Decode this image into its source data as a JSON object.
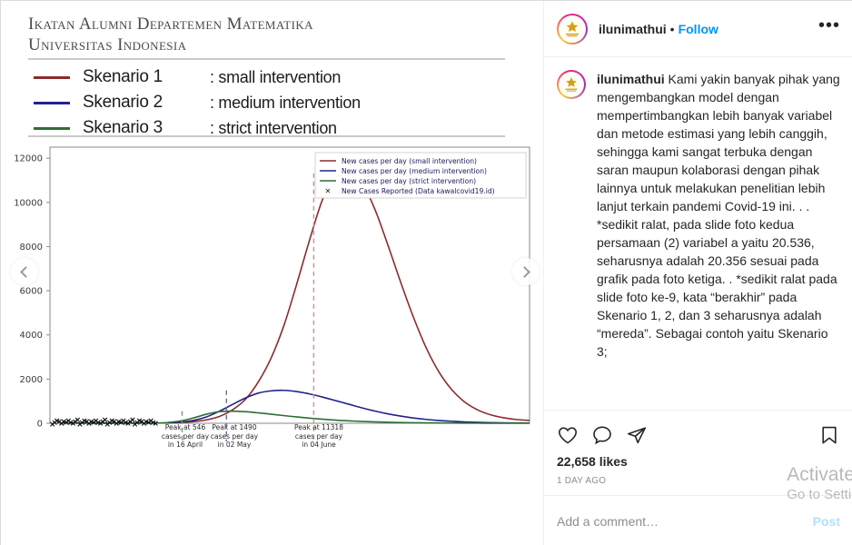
{
  "slide": {
    "title_line1": "Ikatan Alumni Departemen Matematika",
    "title_line2": "Universitas Indonesia",
    "legend": [
      {
        "name": "Skenario 1",
        "desc": ": small intervention",
        "color": "#8c2b2b"
      },
      {
        "name": "Skenario 2",
        "desc": ": medium intervention",
        "color": "#22228c"
      },
      {
        "name": "Skenario 3",
        "desc": ": strict intervention",
        "color": "#2c6e34"
      }
    ]
  },
  "chart_data": {
    "type": "line",
    "title": "",
    "xlabel": "",
    "ylabel": "",
    "ylim": [
      0,
      12500
    ],
    "yticks": [
      0,
      2000,
      4000,
      6000,
      8000,
      10000,
      12000
    ],
    "grid": false,
    "legend_position": "top-right",
    "legend_entries": [
      "New cases per day (small intervention)",
      "New cases per day (medium intervention)",
      "New cases per day (strict intervention)",
      "New Cases Reported (Data kawalcovid19.id)"
    ],
    "series": [
      {
        "name": "New cases per day (small intervention)",
        "color": "#8c2b2b",
        "peak_value": 11318,
        "peak_label": "in 04 June",
        "values": [
          10,
          20,
          40,
          80,
          160,
          320,
          620,
          1100,
          1900,
          3000,
          4500,
          6400,
          8400,
          10200,
          11200,
          11318,
          10900,
          9700,
          8100,
          6400,
          4800,
          3400,
          2300,
          1500,
          950,
          600,
          380,
          250,
          170,
          130
        ]
      },
      {
        "name": "New cases per day (medium intervention)",
        "color": "#22228c",
        "peak_value": 1490,
        "peak_label": "in 02 May",
        "values": [
          10,
          25,
          60,
          140,
          300,
          560,
          860,
          1150,
          1370,
          1470,
          1490,
          1430,
          1320,
          1180,
          1020,
          860,
          700,
          555,
          430,
          325,
          240,
          175,
          125,
          90,
          62,
          44,
          30,
          21,
          15,
          10
        ]
      },
      {
        "name": "New cases per day (strict intervention)",
        "color": "#2c6e34",
        "peak_value": 546,
        "peak_label": "in 16 April",
        "values": [
          12,
          40,
          110,
          250,
          420,
          530,
          546,
          520,
          470,
          410,
          345,
          285,
          230,
          182,
          142,
          110,
          84,
          63,
          47,
          35,
          26,
          19,
          14,
          10,
          7,
          5,
          4,
          3,
          2,
          2
        ]
      }
    ],
    "reported_marker": "x",
    "reported_marker_color": "#111111",
    "annotations": [
      {
        "color": "#2c6e34",
        "line1": "Peak at 546",
        "line2": "cases per day",
        "line3": "in 16 April"
      },
      {
        "color": "#5a5a7a",
        "line1": "Peak at 1490",
        "line2": "cases per day",
        "line3": "in 02 May"
      },
      {
        "color": "#cc7a7a",
        "line1": "Peak at 11318",
        "line2": "cases per day",
        "line3": "in 04 June"
      }
    ]
  },
  "carousel": {
    "prev_label": "Previous",
    "next_label": "Next"
  },
  "post": {
    "username": "ilunimathui",
    "separator": "•",
    "follow_label": "Follow",
    "more_label": "•••",
    "caption_user": "ilunimathui",
    "caption_body": " Kami yakin banyak pihak yang mengembangkan model dengan mempertimbangkan lebih banyak variabel dan metode estimasi yang lebih canggih, sehingga kami sangat terbuka dengan saran maupun kolaborasi dengan pihak lainnya untuk melakukan penelitian lebih lanjut terkain pandemi Covid-19 ini.\n.\n.\n*sedikit ralat, pada slide foto kedua persamaan (2) variabel a yaitu 20.536, seharusnya adalah 20.356 sesuai pada grafik pada foto ketiga.\n.\n*sedikit ralat pada slide foto ke-9, kata “berakhir” pada Skenario 1, 2, dan 3 seharusnya adalah “mereda”.\nSebagai contoh yaitu Skenario 3;",
    "likes": "22,658 likes",
    "timestamp": "1 DAY AGO",
    "comment_placeholder": "Add a comment…",
    "post_label": "Post"
  },
  "watermark": {
    "line1": "Activate",
    "line2": "Go to Setti"
  }
}
